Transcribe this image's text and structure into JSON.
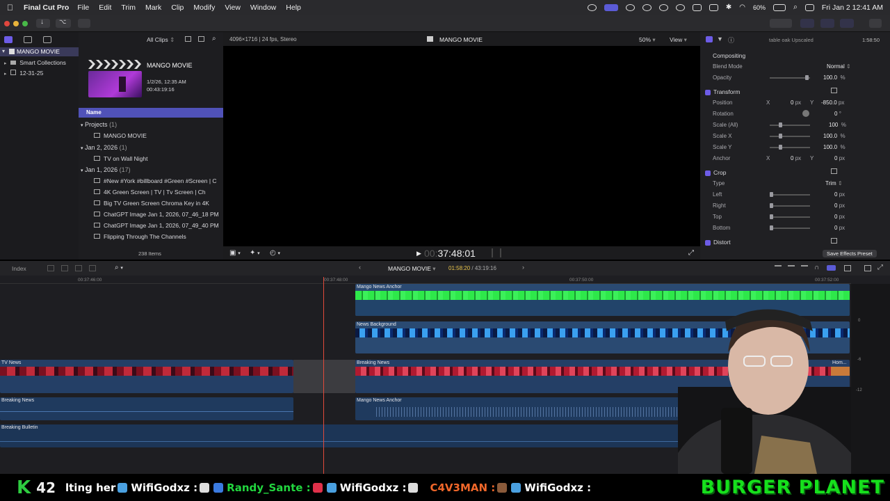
{
  "menubar": {
    "app_name": "Final Cut Pro",
    "items": [
      "File",
      "Edit",
      "Trim",
      "Mark",
      "Clip",
      "Modify",
      "View",
      "Window",
      "Help"
    ],
    "battery": "60%",
    "datetime": "Fri Jan 2  12:41 AM"
  },
  "browser": {
    "filter": "All Clips",
    "library_name": "MANGO MOVIE",
    "sidebar_items": [
      "Smart Collections",
      "12-31-25"
    ],
    "project_title": "MANGO MOVIE",
    "project_date": "1/2/26, 12:35 AM",
    "project_duration": "00:43:19:16",
    "column_name": "Name",
    "groups": [
      {
        "title": "Projects",
        "count": "(1)",
        "items": [
          "MANGO MOVIE"
        ]
      },
      {
        "title": "Jan 2, 2026",
        "count": "(1)",
        "items": [
          "TV on Wall Night"
        ]
      },
      {
        "title": "Jan 1, 2026",
        "count": "(17)",
        "items": [
          "#New #York #billboard #Green #Screen | C",
          "4K Green Screen  |  TV  |  Tv Screen  |  Ch",
          "Big TV Green Screen Chroma Key in 4K",
          "ChatGPT Image Jan 1, 2026, 07_46_18 PM",
          "ChatGPT Image Jan 1, 2026, 07_49_40 PM",
          "Flipping Through The Channels"
        ]
      }
    ],
    "item_count": "238 Items"
  },
  "viewer": {
    "format": "4096×1716 | 24 fps, Stereo",
    "title": "MANGO MOVIE",
    "zoom": "50%",
    "view_label": "View",
    "timecode": "37:48:01"
  },
  "inspector": {
    "clip_name": "table oak Upscaled",
    "duration": "1:58:50",
    "compositing": "Compositing",
    "blend_mode_label": "Blend Mode",
    "blend_mode": "Normal",
    "opacity_label": "Opacity",
    "opacity": "100.0",
    "opacity_unit": "%",
    "transform": "Transform",
    "position_label": "Position",
    "pos_x": "0",
    "pos_y": "-850.0",
    "rotation_label": "Rotation",
    "rotation": "0",
    "scale_all_label": "Scale (All)",
    "scale_all": "100",
    "scale_x_label": "Scale X",
    "scale_x": "100.0",
    "scale_y_label": "Scale Y",
    "scale_y": "100.0",
    "anchor_label": "Anchor",
    "anchor_x": "0",
    "anchor_y": "0",
    "crop": "Crop",
    "type_label": "Type",
    "type_value": "Trim",
    "left_label": "Left",
    "right_label": "Right",
    "top_label": "Top",
    "bottom_label": "Bottom",
    "crop_value": "0",
    "distort": "Distort",
    "save_preset": "Save Effects Preset",
    "px": "px",
    "deg": "°",
    "x": "X",
    "y": "Y"
  },
  "timeline": {
    "index_label": "Index",
    "project": "MANGO MOVIE",
    "tc_current": "01:58:20",
    "tc_total": "43:19:16",
    "ruler": [
      "00:37:46:00",
      "00:37:48:00",
      "00:37:50:00",
      "00:37:52:00"
    ],
    "clips": {
      "anchor_video": "Mango News Anchor",
      "bg_video": "News Background",
      "tv_news": "TV News",
      "breaking_video": "Breaking News",
      "hom": "Hom...",
      "breaking_audio": "Breaking News",
      "anchor_audio": "Mango News Anchor",
      "bulletin": "Breaking Bulletin"
    },
    "meter": [
      "0",
      "-6",
      "-12"
    ]
  },
  "banner": {
    "k_label": "K",
    "viewer_count": "42",
    "chat": [
      {
        "text": "lting her",
        "color": "#ffffff"
      },
      {
        "text": "WifiGodxz :",
        "color": "#ffffff"
      },
      {
        "text": "Randy_Sante :",
        "color": "#22d63f"
      },
      {
        "text": "WifiGodxz :",
        "color": "#ffffff"
      },
      {
        "text": "C4V3MAN :",
        "color": "#f0672a"
      },
      {
        "text": "WifiGodxz :",
        "color": "#ffffff"
      }
    ],
    "brand": "BURGER  PLANET",
    "colors": {
      "green": "#16e01c"
    }
  }
}
